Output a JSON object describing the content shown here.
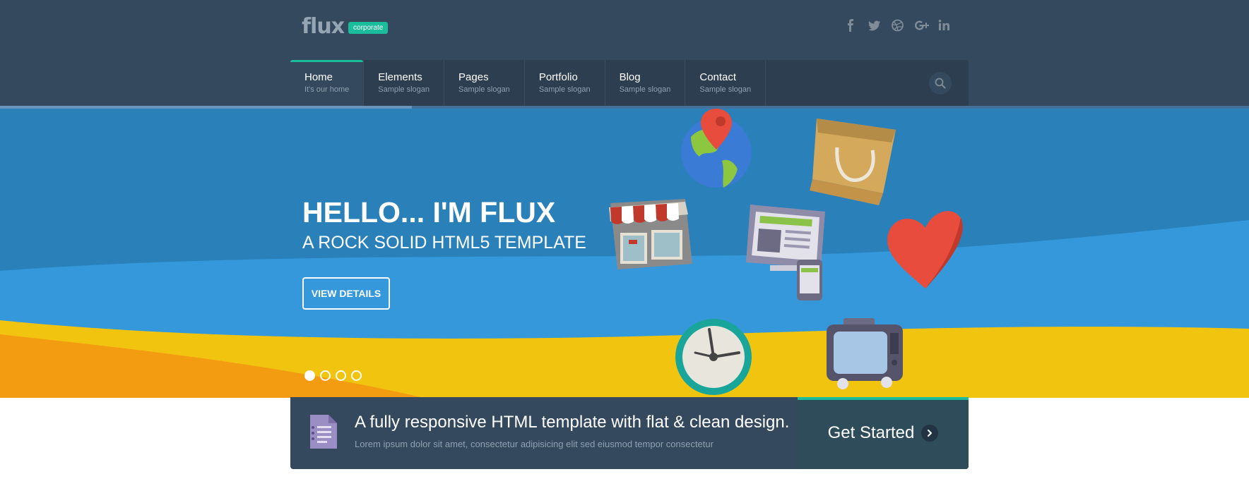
{
  "header": {
    "logo_text": "flux",
    "logo_badge": "corporate",
    "social": [
      {
        "name": "facebook-icon",
        "glyph": "f"
      },
      {
        "name": "twitter-icon",
        "glyph": "t"
      },
      {
        "name": "dribbble-icon",
        "glyph": "d"
      },
      {
        "name": "google-plus-icon",
        "glyph": "g+"
      },
      {
        "name": "linkedin-icon",
        "glyph": "in"
      }
    ]
  },
  "nav": {
    "items": [
      {
        "title": "Home",
        "subtitle": "It's our home"
      },
      {
        "title": "Elements",
        "subtitle": "Sample slogan"
      },
      {
        "title": "Pages",
        "subtitle": "Sample slogan"
      },
      {
        "title": "Portfolio",
        "subtitle": "Sample slogan"
      },
      {
        "title": "Blog",
        "subtitle": "Sample slogan"
      },
      {
        "title": "Contact",
        "subtitle": "Sample slogan"
      }
    ],
    "active_index": 0,
    "search_icon": "search-icon",
    "slider_progress": 0.33
  },
  "hero": {
    "title": "HELLO... I'M FLUX",
    "subtitle": "A ROCK SOLID HTML5 TEMPLATE",
    "button_label": "VIEW DETAILS",
    "slides_count": 4,
    "active_slide": 0,
    "icons": [
      "globe-pin-icon",
      "shopping-bag-icon",
      "shop-front-icon",
      "responsive-devices-icon",
      "heart-icon",
      "clock-icon",
      "tv-icon"
    ]
  },
  "cta": {
    "icon": "document-icon",
    "headline": "A fully responsive HTML template with flat & clean design.",
    "subtext": "Lorem ipsum dolor sit amet, consectetur adipisicing elit sed eiusmod tempor consectetur",
    "button_label": "Get Started",
    "button_icon": "chevron-right-icon"
  },
  "colors": {
    "header_bg": "#34495e",
    "nav_bg": "#2c3e50",
    "accent": "#1abc9c",
    "hero_blue": "#2a80b9",
    "wave_blue": "#3498db",
    "wave_yellow": "#f1c40f",
    "wave_orange": "#f39c12"
  }
}
